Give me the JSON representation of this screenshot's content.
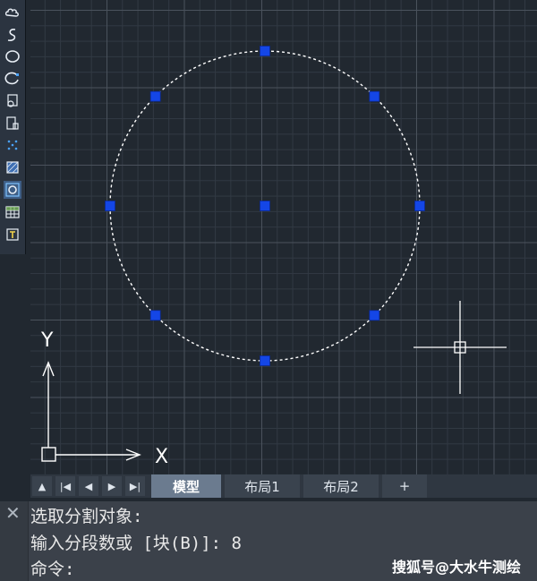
{
  "toolbar": {
    "tools": [
      {
        "icon": "revcloud-icon"
      },
      {
        "icon": "spline-icon"
      },
      {
        "icon": "ellipse-icon"
      },
      {
        "icon": "ellipse-arc-icon"
      },
      {
        "icon": "insert-block-icon"
      },
      {
        "icon": "make-block-icon"
      },
      {
        "icon": "point-icon"
      },
      {
        "icon": "hatch-icon"
      },
      {
        "icon": "region-icon"
      },
      {
        "icon": "table-icon"
      },
      {
        "icon": "multiline-text-icon"
      }
    ]
  },
  "canvas": {
    "ucs_x_label": "X",
    "ucs_y_label": "Y",
    "circle_divisions": 8
  },
  "tabs": {
    "nav": [
      "up-arrow-icon",
      "first-icon",
      "prev-icon",
      "next-icon",
      "last-icon"
    ],
    "items": [
      {
        "label": "模型",
        "active": true
      },
      {
        "label": "布局1",
        "active": false
      },
      {
        "label": "布局2",
        "active": false
      },
      {
        "label": "+",
        "active": false
      }
    ]
  },
  "command": {
    "line1": "选取分割对象:",
    "line2": "输入分段数或 [块(B)]: 8",
    "prompt": "命令:"
  },
  "watermark": "搜狐号@大水牛测绘",
  "colors": {
    "grip": "#1446e6",
    "background": "#212830",
    "circle": "#ffffff"
  }
}
